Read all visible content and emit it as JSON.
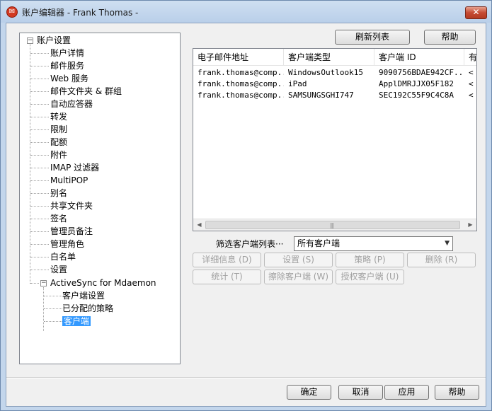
{
  "window": {
    "title": "账户编辑器 - Frank Thomas -",
    "close_label": "✕"
  },
  "tree": {
    "root": {
      "label": "账户设置",
      "toggle": "−"
    },
    "items": [
      "账户详情",
      "邮件服务",
      "Web 服务",
      "邮件文件夹 & 群组",
      "自动应答器",
      "转发",
      "限制",
      "配额",
      "附件",
      "IMAP 过滤器",
      "MultiPOP",
      "别名",
      "共享文件夹",
      "签名",
      "管理员备注",
      "管理角色",
      "白名单",
      "设置"
    ],
    "activesync": {
      "label": "ActiveSync for Mdaemon",
      "toggle": "−",
      "children": [
        "客户端设置",
        "已分配的策略",
        "客户端"
      ],
      "selected": "客户端"
    }
  },
  "toolbar": {
    "refresh_label": "刷新列表",
    "help_label": "帮助"
  },
  "clients_table": {
    "columns": [
      "电子邮件地址",
      "客户端类型",
      "客户端 ID",
      "有"
    ],
    "rows": [
      [
        "frank.thomas@comp...",
        "WindowsOutlook15",
        "9090756BDAE942CF...",
        "<"
      ],
      [
        "frank.thomas@comp...",
        "iPad",
        "ApplDMRJJX05F182",
        "<"
      ],
      [
        "frank.thomas@comp...",
        "SAMSUNGSGHI747",
        "SEC192C55F9C4C8A",
        "<"
      ]
    ],
    "scroll_left": "◀",
    "scroll_right": "▶",
    "scroll_grip": "|||"
  },
  "filter": {
    "label": "筛选客户端列表···",
    "selected": "所有客户端",
    "arrow": "▼"
  },
  "actions": {
    "details": "详细信息 (D)",
    "settings": "设置 (S)",
    "policy": "策略 (P)",
    "delete": "删除 (R)",
    "stats": "统计 (T)",
    "wipe": "擦除客户端 (W)",
    "authorize": "授权客户端 (U)"
  },
  "footer": {
    "ok": "确定",
    "cancel": "取消",
    "apply": "应用",
    "help": "帮助"
  }
}
